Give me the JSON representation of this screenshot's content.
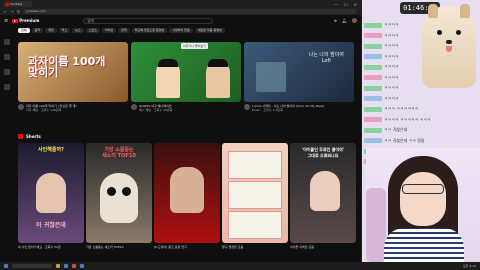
{
  "browser": {
    "tab_label": "YouTube",
    "url": "youtube.com",
    "window_buttons": [
      "—",
      "☐",
      "✕"
    ]
  },
  "youtube": {
    "logo_text": "Premium",
    "search_placeholder": "검색",
    "chips": [
      "전체",
      "음악",
      "게임",
      "믹스",
      "뉴스",
      "스포츠",
      "라이브",
      "만화",
      "최근에 업로드된 동영상",
      "시청하지 않음",
      "새로운 맞춤 동영상"
    ],
    "videos": [
      {
        "thumb_title": "과자이름 100개\n맞히기",
        "title": "과자 이름 100개 맞히기 | 당신은 몇 개?",
        "channel": "과자 채널 · 조회수 128만회"
      },
      {
        "thumb_head": "아무거나 물어보기",
        "title": "GIANTS 야구 애니메이션",
        "channel": "애니 채널 · 조회수 56만회"
      },
      {
        "thumb_text": "나는 나의 밤이야\nLofi",
        "title": "Lumos (미래) - 사는 나의 밤이야 (Vicio Art My Dear)",
        "channel": "Music · 조회수 3.2만회"
      }
    ],
    "shorts_label": "Shorts",
    "shorts": [
      {
        "top": "사인해줄까?",
        "bottom": "아 귀찮은데",
        "caption": "내 사인 받아가세요 · 조회수 51만"
      },
      {
        "top": "가장 소름돋는\n새소리 TOP10",
        "caption": "가장 소름돋는 새소리 TOP10"
      },
      {
        "top": "",
        "caption": "[K-드라마] 원조 표정 연기"
      },
      {
        "top": "",
        "caption": "짱구 명장면 모음"
      },
      {
        "top": "'아이돌인 무료인 줄이야'\n그대로 오류되나요",
        "caption": "아이돌 리액션 모음"
      }
    ]
  },
  "taskbar": {
    "clock": "오후 3:12"
  },
  "stream": {
    "timer": "01:46:11",
    "chat": [
      "ㅋㅋㅋㅋ",
      "ㅋㅋㅋㅋ",
      "ㅋㅋㅋㅋ",
      "ㅋㅋㅋㅋ",
      "ㅋㅋㅋㅋ",
      "ㅋㅋㅋㅋ",
      "ㅋㅋㅋㅋ",
      "ㅋㅋㅋㅋ",
      "ㅋㅋㅋ ㅋㅋㅋㅋㅋㅋ",
      "ㅋㅋㅋㅋ ㅋㅋㅋㅋㅋ ㅋㅋㅋ",
      "ㅋㅋ 귀찮은데",
      "ㅋㅋ 귀찮은데 ㅋㅋ 정말",
      "ㅋㅋ 진짜 감동",
      "ㅋㅋㅋ 찻인해줄까 정말 감동임"
    ]
  }
}
